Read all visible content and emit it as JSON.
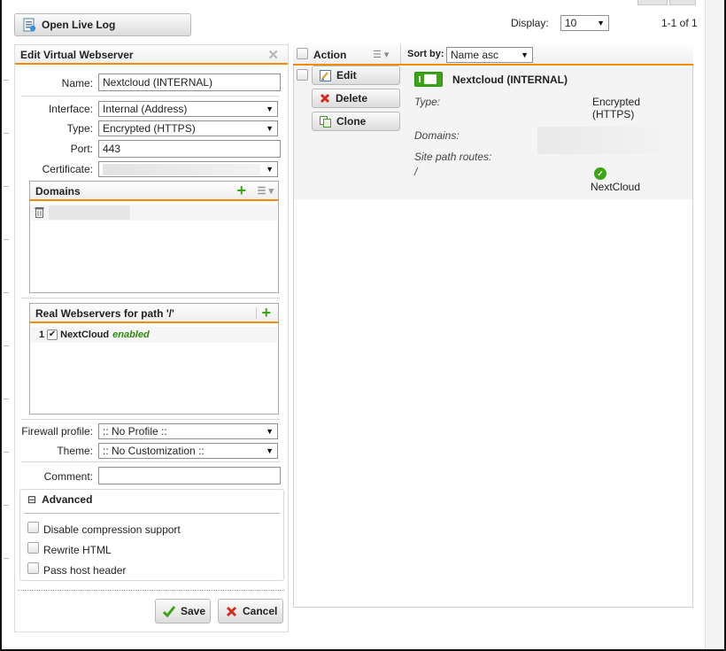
{
  "toolbar": {
    "open_live_log": "Open Live Log",
    "display_label": "Display:",
    "display_value": "10",
    "pagination": "1-1 of 1"
  },
  "edit_panel": {
    "title": "Edit Virtual Webserver",
    "name_label": "Name:",
    "name_value": "Nextcloud (INTERNAL)",
    "interface_label": "Interface:",
    "interface_value": "Internal (Address)",
    "type_label": "Type:",
    "type_value": "Encrypted (HTTPS)",
    "port_label": "Port:",
    "port_value": "443",
    "certificate_label": "Certificate:",
    "domains_title": "Domains",
    "real_title": "Real Webservers for path '/'",
    "real_items": [
      {
        "index": "1",
        "name": "NextCloud",
        "status": "enabled"
      }
    ],
    "firewall_label": "Firewall profile:",
    "firewall_value": ":: No Profile ::",
    "theme_label": "Theme:",
    "theme_value": ":: No Customization ::",
    "comment_label": "Comment:",
    "comment_value": "",
    "advanced_title": "Advanced",
    "advanced_toggle": "⊟",
    "options": [
      {
        "label": "Disable compression support",
        "checked": false
      },
      {
        "label": "Rewrite HTML",
        "checked": false
      },
      {
        "label": "Pass host header",
        "checked": false
      }
    ],
    "save_label": "Save",
    "cancel_label": "Cancel"
  },
  "list": {
    "action_label": "Action",
    "sort_by_label": "Sort by:",
    "sort_value": "Name asc",
    "buttons": {
      "edit": "Edit",
      "delete": "Delete",
      "clone": "Clone"
    },
    "item": {
      "name": "Nextcloud (INTERNAL)",
      "type_label": "Type:",
      "type_value": "Encrypted (HTTPS)",
      "domains_label": "Domains:",
      "routes_label": "Site path routes:",
      "route_path": "/",
      "route_server": "NextCloud"
    }
  },
  "colors": {
    "accent": "#f28c00",
    "toggle_on": "#3aa616",
    "save_green": "#3aa616",
    "cancel_red": "#d42a1f"
  }
}
